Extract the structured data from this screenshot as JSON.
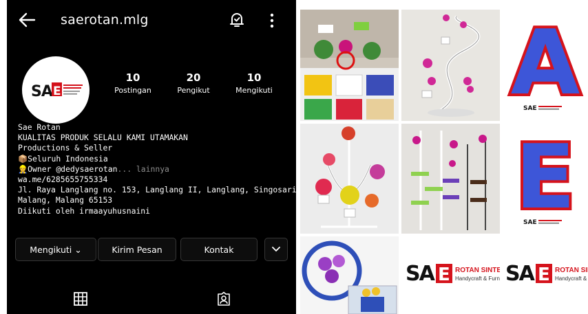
{
  "profile": {
    "username": "saerotan.mlg",
    "stats": [
      {
        "value": "10",
        "label": "Postingan"
      },
      {
        "value": "20",
        "label": "Pengikut"
      },
      {
        "value": "10",
        "label": "Mengikuti"
      }
    ],
    "bio": {
      "name": "Sae Rotan",
      "tagline": "KUALITAS PRODUK SELALU KAMI UTAMAKAN",
      "category": "Productions & Seller",
      "area": "📦Seluruh Indonesia",
      "owner": "👷Owner @dedysaerotan",
      "more": "... lainnya",
      "link": "wa.me/6285655755334",
      "address1": "Jl. Raya Langlang no. 153, Langlang II, Langlang, Singosari,",
      "address2": "Malang, Malang 65153",
      "followed_by": "Diikuti oleh irmaayuhusnaini"
    },
    "logo_text": "SAE",
    "logo_sub": "ROTAN SINTETIS"
  },
  "buttons": {
    "following": "Mengikuti ⌄",
    "message": "Kirim Pesan",
    "contact": "Kontak"
  },
  "icons": {
    "back": "arrow-left-icon",
    "bell": "notification-bell-icon",
    "menu": "kebab-menu-icon",
    "grid": "grid-icon",
    "tagged": "tagged-person-icon",
    "chevron": "chevron-down-icon"
  },
  "posts": [
    {
      "kind": "photo",
      "letter": ""
    },
    {
      "kind": "photo",
      "letter": ""
    },
    {
      "kind": "letter",
      "letter": "A",
      "brand": "SAE"
    },
    {
      "kind": "photo",
      "letter": ""
    },
    {
      "kind": "photo",
      "letter": ""
    },
    {
      "kind": "letter",
      "letter": "E",
      "brand": "SAE"
    },
    {
      "kind": "photo",
      "letter": ""
    },
    {
      "kind": "logo",
      "brand": "SAE",
      "sub1": "ROTAN SINTETIS",
      "sub2": "Handycraft & Furniture"
    },
    {
      "kind": "logo",
      "brand": "SAE",
      "sub1": "ROTAN SINTET",
      "sub2": "Handycraft & Furnitu"
    }
  ]
}
